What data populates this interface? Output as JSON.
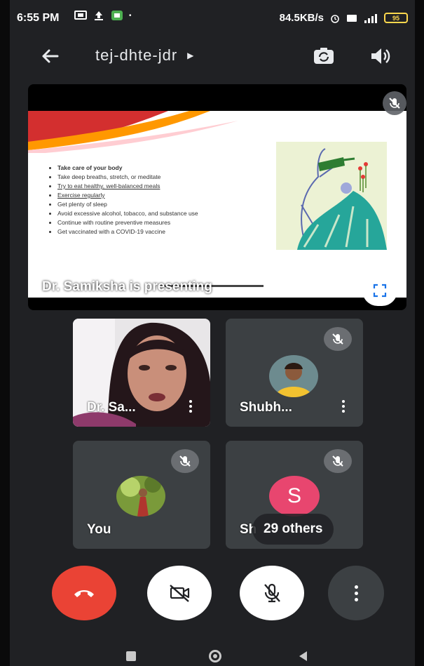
{
  "status_bar": {
    "time": "6:55 PM",
    "network_speed": "84.5KB/s",
    "battery_level": "95"
  },
  "top_bar": {
    "meeting_code": "tej-dhte-jdr",
    "icons": [
      "back-arrow-icon",
      "switch-camera-icon",
      "speaker-icon"
    ]
  },
  "presentation": {
    "slide_bullets": [
      "Take care of your body",
      "Take deep breaths, stretch, or meditate",
      "Try to eat healthy, well-balanced meals",
      "Exercise regularly",
      "Get plenty of sleep",
      "Avoid excessive alcohol, tobacco, and substance use",
      "Continue with routine preventive measures",
      "Get vaccinated with a COVID-19 vaccine"
    ],
    "presenter_label": "Dr. Samiksha is presenting"
  },
  "participants": [
    {
      "name": "Dr. Sa...",
      "type": "video"
    },
    {
      "name": "Shubh...",
      "type": "avatar",
      "muted": true
    },
    {
      "name": "You",
      "type": "avatar",
      "muted": true
    },
    {
      "name": "Sh",
      "type": "letter",
      "letter": "S",
      "muted": true,
      "overflow_label": "29 others"
    }
  ],
  "controls": [
    "end-call",
    "camera-off",
    "mic-off",
    "more-options"
  ],
  "colors": {
    "background": "#202124",
    "tile": "#3c4043",
    "end_call": "#ea4335",
    "letter_avatar": "#e8466f"
  }
}
